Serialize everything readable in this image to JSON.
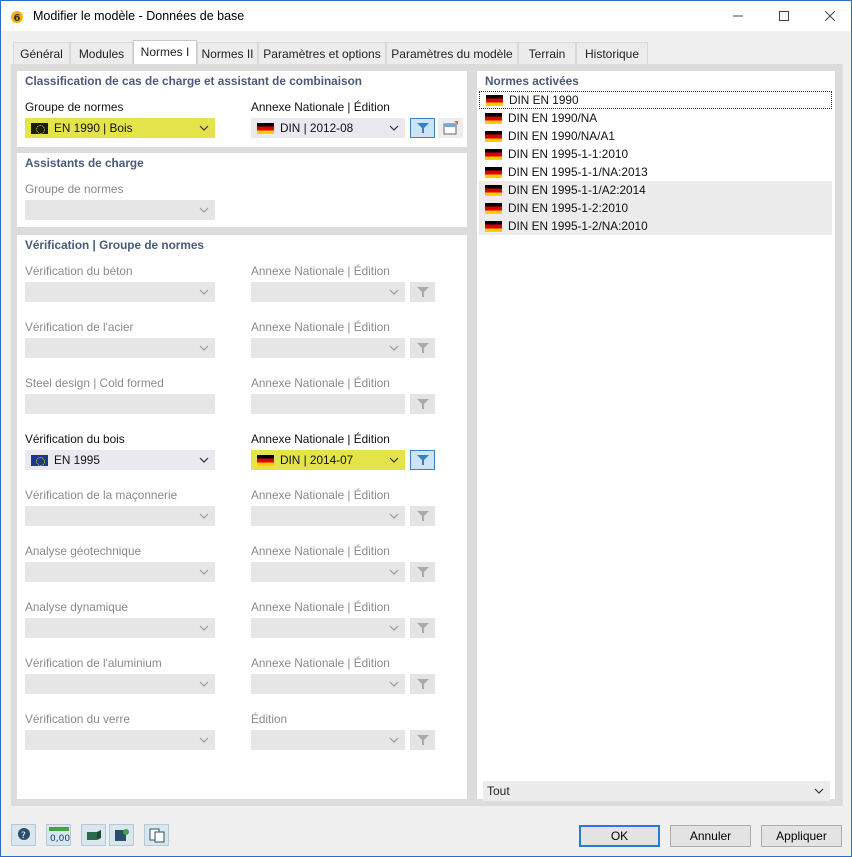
{
  "window": {
    "title": "Modifier le modèle - Données de base"
  },
  "tabs": [
    {
      "label": "Général"
    },
    {
      "label": "Modules"
    },
    {
      "label": "Normes I"
    },
    {
      "label": "Normes II"
    },
    {
      "label": "Paramètres et options"
    },
    {
      "label": "Paramètres du modèle"
    },
    {
      "label": "Terrain"
    },
    {
      "label": "Historique"
    }
  ],
  "classification": {
    "title": "Classification de cas de charge et assistant de combinaison",
    "group_label": "Groupe de normes",
    "group_value": "EN 1990 | Bois",
    "annex_label": "Annexe Nationale | Édition",
    "annex_value": "DIN | 2012-08"
  },
  "load_wizards": {
    "title": "Assistants de charge",
    "group_label": "Groupe de normes"
  },
  "verification": {
    "title": "Vérification | Groupe de normes",
    "rows": [
      {
        "label": "Vérification du béton",
        "annex_label": "Annexe Nationale | Édition",
        "value": "",
        "annex_value": ""
      },
      {
        "label": "Vérification de l'acier",
        "annex_label": "Annexe Nationale | Édition",
        "value": "",
        "annex_value": ""
      },
      {
        "label": "Steel design | Cold formed",
        "annex_label": "Annexe Nationale | Édition",
        "value": "",
        "annex_value": ""
      },
      {
        "label": "Vérification du bois",
        "annex_label": "Annexe Nationale | Édition",
        "value": "EN 1995",
        "annex_value": "DIN | 2014-07"
      },
      {
        "label": "Vérification de la maçonnerie",
        "annex_label": "Annexe Nationale | Édition",
        "value": "",
        "annex_value": ""
      },
      {
        "label": "Analyse géotechnique",
        "annex_label": "Annexe Nationale | Édition",
        "value": "",
        "annex_value": ""
      },
      {
        "label": "Analyse dynamique",
        "annex_label": "Annexe Nationale | Édition",
        "value": "",
        "annex_value": ""
      },
      {
        "label": "Vérification de l'aluminium",
        "annex_label": "Annexe Nationale | Édition",
        "value": "",
        "annex_value": ""
      },
      {
        "label": "Vérification du verre",
        "annex_label": "Édition",
        "value": "",
        "annex_value": ""
      }
    ]
  },
  "active_norms": {
    "title": "Normes activées",
    "items": [
      "DIN EN 1990",
      "DIN EN 1990/NA",
      "DIN EN 1990/NA/A1",
      "DIN EN 1995-1-1:2010",
      "DIN EN 1995-1-1/NA:2013",
      "DIN EN 1995-1-1/A2:2014",
      "DIN EN 1995-1-2:2010",
      "DIN EN 1995-1-2/NA:2010"
    ],
    "filter_value": "Tout"
  },
  "toolbar": {
    "units_text": "0,00"
  },
  "buttons": {
    "ok": "OK",
    "cancel": "Annuler",
    "apply": "Appliquer"
  },
  "colors": {
    "highlight": "#e4e44a",
    "panel_title": "#4a5a7a",
    "accent": "#2b7bd4"
  }
}
